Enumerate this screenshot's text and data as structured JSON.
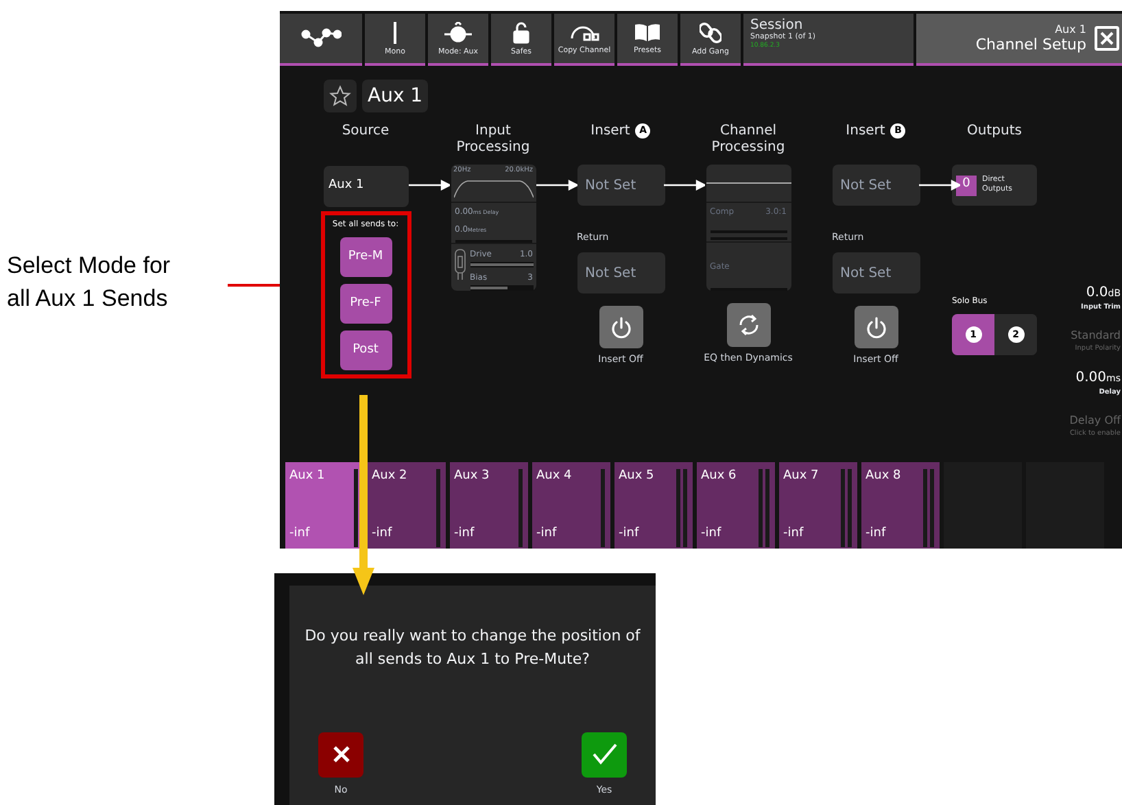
{
  "annotation": {
    "text": "Select Mode for all Aux 1 Sends"
  },
  "toolbar": {
    "items": [
      {
        "label": "Mono"
      },
      {
        "label": "Mode: Aux"
      },
      {
        "label": "Safes"
      },
      {
        "label": "Copy Channel"
      },
      {
        "label": "Presets"
      },
      {
        "label": "Add Gang"
      }
    ],
    "session": {
      "title": "Session",
      "snapshot": "Snapshot 1 (of 1)",
      "address": "10.86.2.3"
    },
    "channel": {
      "name": "Aux 1",
      "title": "Channel Setup"
    }
  },
  "channel_name": "Aux 1",
  "source": {
    "header": "Source",
    "value": "Aux 1",
    "sends_label": "Set all sends to:",
    "send_buttons": [
      "Pre-M",
      "Pre-F",
      "Post"
    ]
  },
  "input_processing": {
    "header": "Input Processing",
    "low": "20Hz",
    "high": "20.0kHz",
    "delay_value": "0.00",
    "delay_unit": "ms Delay",
    "metres_value": "0.0",
    "metres_unit": "Metres",
    "drive": {
      "label": "Drive",
      "value": "1.0",
      "level": 1
    },
    "bias": {
      "label": "Bias",
      "value": "3",
      "level": 0.6
    }
  },
  "insert_a": {
    "header": "Insert",
    "badge": "A",
    "send": "Not Set",
    "return_label": "Return",
    "return": "Not Set",
    "button_label": "Insert Off",
    "on": false
  },
  "channel_processing": {
    "header": "Channel Processing",
    "comp_label": "Comp",
    "comp_value": "3.0:1",
    "gate_label": "Gate",
    "order": "EQ then Dynamics"
  },
  "insert_b": {
    "header": "Insert",
    "badge": "B",
    "send": "Not Set",
    "return_label": "Return",
    "return": "Not Set",
    "button_label": "Insert Off",
    "on": false
  },
  "outputs": {
    "header": "Outputs",
    "count": "0",
    "label": "Direct Outputs",
    "solo_label": "Solo Bus",
    "solo": [
      {
        "label": "1",
        "selected": true
      },
      {
        "label": "2",
        "selected": false
      }
    ]
  },
  "readings": [
    {
      "value": "0.0",
      "unit": "dB",
      "label": "Input Trim",
      "dim": false
    },
    {
      "value": "Standard",
      "label": "Input Polarity",
      "dim": true
    },
    {
      "value": "0.00",
      "unit": "ms",
      "label": "Delay",
      "dim": false
    },
    {
      "value": "Delay Off",
      "label": "Click to enable",
      "dim": true
    }
  ],
  "aux_strips": [
    {
      "name": "Aux 1",
      "level": "-inf",
      "selected": true,
      "stereo": false
    },
    {
      "name": "Aux 2",
      "level": "-inf",
      "selected": false,
      "stereo": false
    },
    {
      "name": "Aux 3",
      "level": "-inf",
      "selected": false,
      "stereo": false
    },
    {
      "name": "Aux 4",
      "level": "-inf",
      "selected": false,
      "stereo": false
    },
    {
      "name": "Aux 5",
      "level": "-inf",
      "selected": false,
      "stereo": true
    },
    {
      "name": "Aux 6",
      "level": "-inf",
      "selected": false,
      "stereo": true
    },
    {
      "name": "Aux 7",
      "level": "-inf",
      "selected": false,
      "stereo": true
    },
    {
      "name": "Aux 8",
      "level": "-inf",
      "selected": false,
      "stereo": true
    }
  ],
  "dialog": {
    "message": "Do you really want to change the position of all sends to Aux 1 to Pre-Mute?",
    "no": "No",
    "yes": "Yes"
  }
}
